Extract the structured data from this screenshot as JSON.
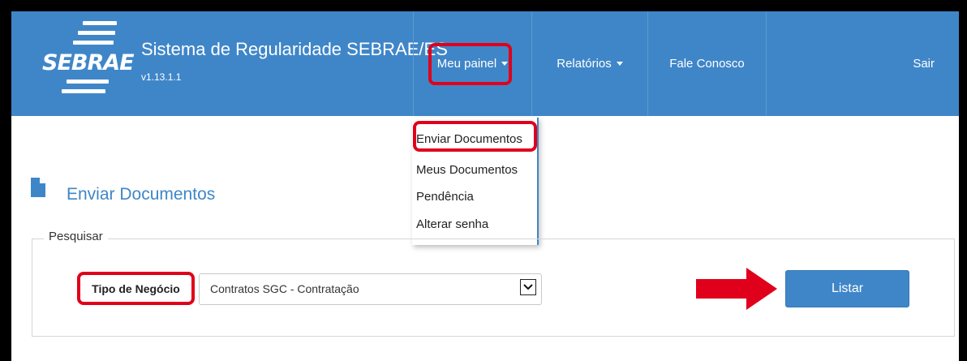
{
  "app": {
    "brand": "SEBRAE",
    "title": "Sistema de Regularidade SEBRAE/ES",
    "version": "v1.13.1.1"
  },
  "nav": {
    "items": [
      {
        "label": "Meu painel",
        "has_caret": true,
        "highlighted": true
      },
      {
        "label": "Relatórios",
        "has_caret": true
      },
      {
        "label": "Fale Conosco",
        "has_caret": false
      },
      {
        "label": "Sair",
        "has_caret": false
      }
    ]
  },
  "dropdown": {
    "items": [
      {
        "label": "Enviar Documentos",
        "highlighted": true
      },
      {
        "label": "Meus Documentos"
      },
      {
        "label": "Pendência"
      },
      {
        "label": "Alterar senha"
      }
    ]
  },
  "page": {
    "title": "Enviar Documentos",
    "icon": "document-icon"
  },
  "search": {
    "legend": "Pesquisar",
    "business_type_label": "Tipo de Negócio",
    "business_type_value": "Contratos SGC - Contratação",
    "list_button": "Listar"
  },
  "colors": {
    "primary": "#3f86c8",
    "highlight": "#e0001b",
    "frame": "#000000"
  }
}
